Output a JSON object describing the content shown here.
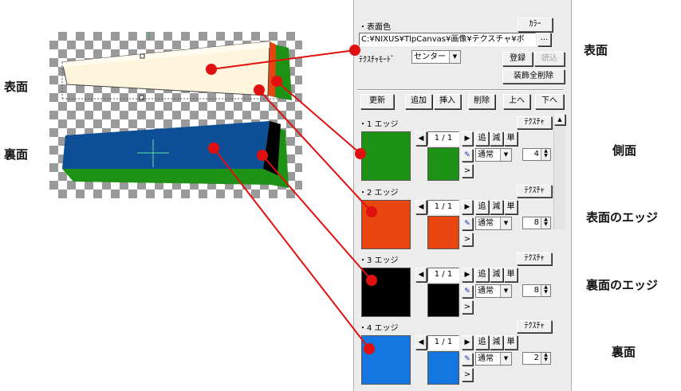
{
  "labels": {
    "omote_left": "表面",
    "ura_left": "裏面",
    "omote_right": "表面",
    "sokumen": "側面",
    "omote_edge": "表面のエッジ",
    "ura_edge": "裏面のエッジ",
    "ura_right": "裏面"
  },
  "panel": {
    "surface_color_label": "・表面色",
    "color_button": "ｶﾗｰ",
    "texture_path": "C:¥NIXUS¥TlpCanvas¥画像¥テクスチャ¥ボ",
    "browse_button": "...",
    "texture_mode_label": "ﾃｸｽﾁｬﾓｰﾄﾞ",
    "texture_mode_value": "センター",
    "register_button": "登録",
    "load_button": "読込",
    "clear_all_button": "装飾全削除",
    "toolbar": [
      "更新",
      "追加",
      "挿入",
      "削除",
      "上へ",
      "下へ"
    ],
    "edges": [
      {
        "title": "・1 エッジ",
        "texture": "ﾃｸｽﾁｬ",
        "color": "#1e9214",
        "page": "1 / 1",
        "add": "追",
        "minus": "減",
        "single": "単",
        "mode": "通常",
        "width": "4"
      },
      {
        "title": "・2 エッジ",
        "texture": "ﾃｸｽﾁｬ",
        "color": "#e8460e",
        "page": "1 / 1",
        "add": "追",
        "minus": "減",
        "single": "単",
        "mode": "通常",
        "width": "8"
      },
      {
        "title": "・3 エッジ",
        "texture": "ﾃｸｽﾁｬ",
        "color": "#000000",
        "page": "1 / 1",
        "add": "追",
        "minus": "減",
        "single": "単",
        "mode": "通常",
        "width": "8"
      },
      {
        "title": "・4 エッジ",
        "texture": "ﾃｸｽﾁｬ",
        "color": "#1476e0",
        "page": "1 / 1",
        "add": "追",
        "minus": "減",
        "single": "単",
        "mode": "通常",
        "width": "2"
      }
    ],
    "more_button": ">",
    "prev_icon": "left-triangle",
    "next_icon": "right-triangle",
    "eyedropper_icon": "eyedropper"
  },
  "colors": {
    "callout": "#e01010",
    "face_top": "#fff5dc",
    "face_bottom": "#0d4f96",
    "side": "#1e9214",
    "edge_orange": "#e8460e"
  }
}
